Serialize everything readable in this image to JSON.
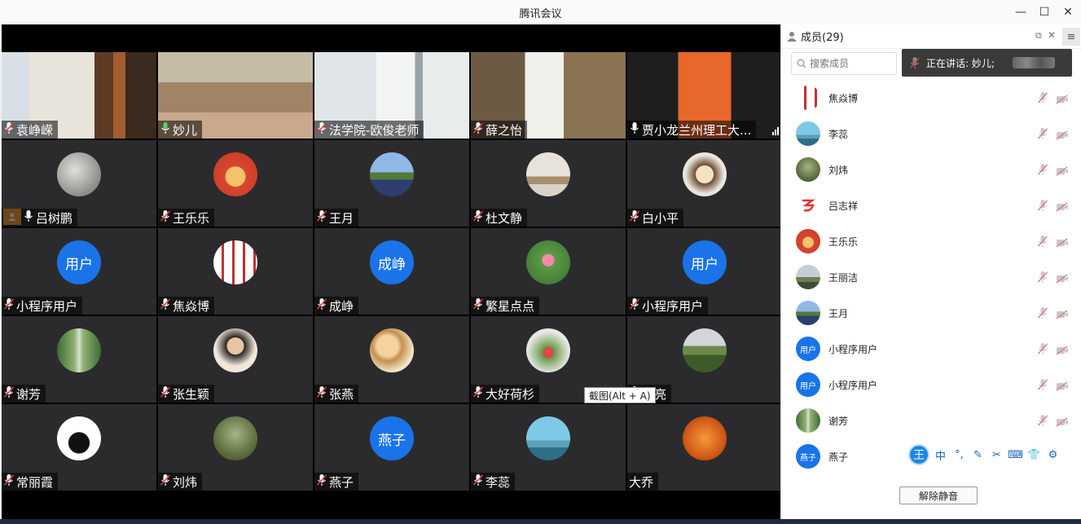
{
  "window": {
    "title": "腾讯会议"
  },
  "tooltip": "截图(Alt + A)",
  "tiles": [
    {
      "name": "袁峥嵘",
      "kind": "photo",
      "scene": "bookshelf",
      "mic": "off"
    },
    {
      "name": "妙儿",
      "kind": "photo",
      "scene": "sofa",
      "mic": "on",
      "speaking": true
    },
    {
      "name": "法学院-欧俊老师",
      "kind": "photo",
      "scene": "office",
      "mic": "off"
    },
    {
      "name": "薛之怡",
      "kind": "photo",
      "scene": "woman",
      "mic": "off"
    },
    {
      "name": "贾小龙兰州理工大...",
      "kind": "photo",
      "scene": "banner",
      "mic": "on",
      "signal": true
    },
    {
      "name": "吕树鹏",
      "kind": "avatar",
      "avatar": "sketch",
      "mic": "on",
      "role_badge": true
    },
    {
      "name": "王乐乐",
      "kind": "avatar",
      "avatar": "cartoon-red",
      "mic": "off"
    },
    {
      "name": "王月",
      "kind": "avatar",
      "avatar": "landscape",
      "mic": "off"
    },
    {
      "name": "杜文静",
      "kind": "avatar",
      "avatar": "glass",
      "mic": "off"
    },
    {
      "name": "白小平",
      "kind": "avatar",
      "avatar": "cartoon-girl",
      "mic": "off"
    },
    {
      "name": "小程序用户",
      "kind": "avatar",
      "avatar": "text",
      "avatar_text": "用户",
      "mic": "off"
    },
    {
      "name": "焦焱博",
      "kind": "avatar",
      "avatar": "seal",
      "mic": "off"
    },
    {
      "name": "成峥",
      "kind": "avatar",
      "avatar": "text",
      "avatar_text": "成峥",
      "mic": "off"
    },
    {
      "name": "繁星点点",
      "kind": "avatar",
      "avatar": "lotus",
      "mic": "off"
    },
    {
      "name": "小程序用户",
      "kind": "avatar",
      "avatar": "text",
      "avatar_text": "用户",
      "mic": "off"
    },
    {
      "name": "谢芳",
      "kind": "avatar",
      "avatar": "trees",
      "mic": "off"
    },
    {
      "name": "张生颖",
      "kind": "avatar",
      "avatar": "portrait",
      "mic": "off"
    },
    {
      "name": "张燕",
      "kind": "avatar",
      "avatar": "child",
      "mic": "off"
    },
    {
      "name": "大好荷杉",
      "kind": "avatar",
      "avatar": "garden",
      "mic": "off"
    },
    {
      "name": "有亮",
      "kind": "avatar",
      "avatar": "man-field",
      "mic": "off"
    },
    {
      "name": "常丽霞",
      "kind": "avatar",
      "avatar": "ink",
      "mic": "off"
    },
    {
      "name": "刘炜",
      "kind": "avatar",
      "avatar": "forest",
      "mic": "off"
    },
    {
      "name": "燕子",
      "kind": "avatar",
      "avatar": "text",
      "avatar_text": "燕子",
      "mic": "off"
    },
    {
      "name": "李蕊",
      "kind": "avatar",
      "avatar": "sky",
      "mic": "off"
    },
    {
      "name": "大乔",
      "kind": "avatar",
      "avatar": "orange",
      "mic": "none"
    }
  ],
  "panel": {
    "title": "成员(29)",
    "search_placeholder": "搜索成员",
    "speaking_label": "正在讲话: 妙儿;",
    "members": [
      {
        "name": "焦焱博",
        "avatar": "seal"
      },
      {
        "name": "李蕊",
        "avatar": "sky"
      },
      {
        "name": "刘炜",
        "avatar": "forest"
      },
      {
        "name": "吕志祥",
        "avatar": "red-mark"
      },
      {
        "name": "王乐乐",
        "avatar": "cartoon-red"
      },
      {
        "name": "王丽洁",
        "avatar": "landscape2"
      },
      {
        "name": "王月",
        "avatar": "landscape"
      },
      {
        "name": "小程序用户",
        "avatar": "text",
        "avatar_text": "用户"
      },
      {
        "name": "小程序用户",
        "avatar": "text",
        "avatar_text": "用户"
      },
      {
        "name": "谢芳",
        "avatar": "trees"
      },
      {
        "name": "燕子",
        "avatar": "text",
        "avatar_text": "燕子"
      }
    ],
    "unmute_label": "解除静音"
  },
  "ime_toolbar": {
    "logo": "王",
    "buttons": [
      "中",
      "°,",
      "✎",
      "✂",
      "⌨",
      "👕",
      "⚙"
    ]
  },
  "colors": {
    "accent": "#1a73e8",
    "speaking": "#2fae52",
    "mic_off": "#e53935"
  }
}
